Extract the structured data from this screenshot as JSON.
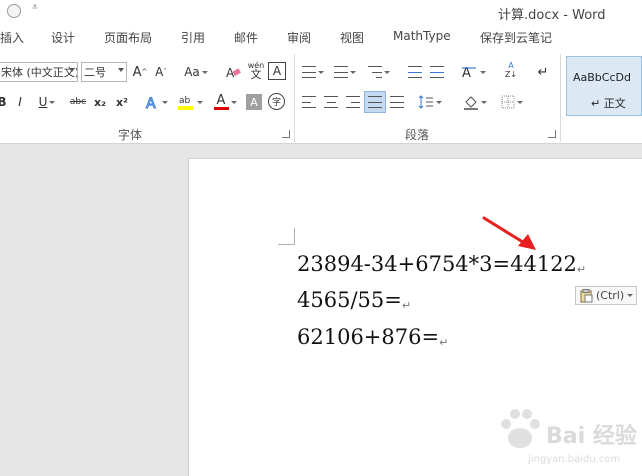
{
  "window": {
    "title": "计算.docx - Word"
  },
  "tabs": [
    {
      "label": "插入"
    },
    {
      "label": "设计"
    },
    {
      "label": "页面布局"
    },
    {
      "label": "引用"
    },
    {
      "label": "邮件"
    },
    {
      "label": "审阅"
    },
    {
      "label": "视图"
    },
    {
      "label": "MathType"
    },
    {
      "label": "保存到云笔记"
    }
  ],
  "ribbon": {
    "font_name": "宋体 (中文正文)",
    "font_size": "二号",
    "font_group_label": "字体",
    "paragraph_group_label": "段落",
    "change_case_label": "Aa",
    "phonetic_label": "wén",
    "bold_label": "B",
    "italic_label": "I",
    "underline_label": "U",
    "strike_label": "abc",
    "subscript_label": "x₂",
    "superscript_label": "x²",
    "font_color_label": "A",
    "shading_label": "A",
    "enclose_label": "字",
    "style_sample": "AaBbCcDd",
    "style_name": "↵ 正文"
  },
  "document": {
    "lines": [
      "23894-34+6754*3=44122",
      "4565/55=",
      "62106+876="
    ],
    "paragraph_mark": "↵"
  },
  "paste_options": {
    "label": "(Ctrl)"
  },
  "watermark": {
    "text": "Bai 经验",
    "sub": "jingyan.baidu.com"
  },
  "colors": {
    "highlight": "#ffff00",
    "font_color": "#e00000",
    "arrow": "#e8201f",
    "style_selected": "#dce9f5"
  }
}
